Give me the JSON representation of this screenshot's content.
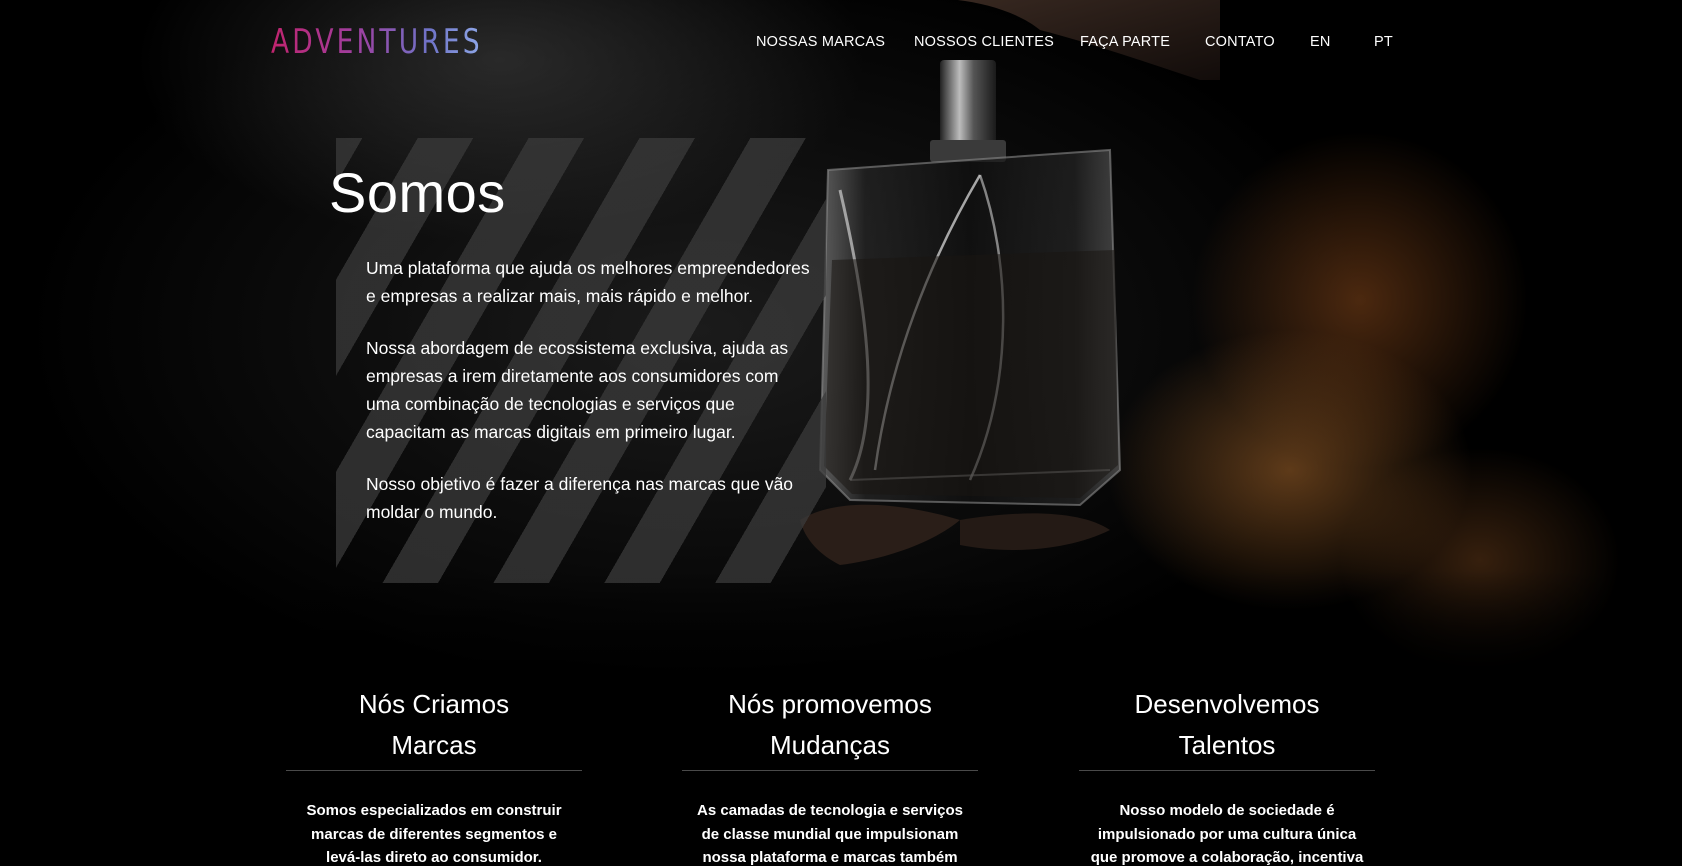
{
  "brand": {
    "logo_text": "ADVENTURES",
    "logo_gradient": [
      "#c0246e",
      "#9f3fa0",
      "#6f74c8",
      "#8fa8e8"
    ]
  },
  "nav": {
    "items": [
      {
        "label": "NOSSAS MARCAS"
      },
      {
        "label": "NOSSOS CLIENTES"
      },
      {
        "label": "FAÇA PARTE"
      },
      {
        "label": "CONTATO"
      },
      {
        "label": "EN"
      },
      {
        "label": "PT"
      }
    ]
  },
  "hero": {
    "title": "Somos",
    "paragraphs": [
      "Uma plataforma que ajuda os melhores empreendedores e empresas a realizar mais, mais rápido e melhor.",
      "Nossa abordagem de ecossistema exclusiva, ajuda as empresas a irem diretamente aos consumidores com uma combinação de tecnologias e serviços que capacitam as marcas digitais em primeiro lugar.",
      "Nosso objetivo é fazer a diferença nas marcas que vão moldar o mundo."
    ],
    "image": "perfume-bottle-spray"
  },
  "features": [
    {
      "title_line1": "Nós Criamos",
      "title_line2": "Marcas",
      "text": "Somos especializados em construir marcas de diferentes segmentos e levá-las direto ao consumidor. Escalamos"
    },
    {
      "title_line1": "Nós promovemos",
      "title_line2": "Mudanças",
      "text": "As camadas de tecnologia e serviços de classe mundial que impulsionam nossa plataforma e marcas também geram"
    },
    {
      "title_line1": "Desenvolvemos",
      "title_line2": "Talentos",
      "text": "Nosso modelo de sociedade é impulsionado por uma cultura única que promove a colaboração, incentiva a"
    }
  ]
}
